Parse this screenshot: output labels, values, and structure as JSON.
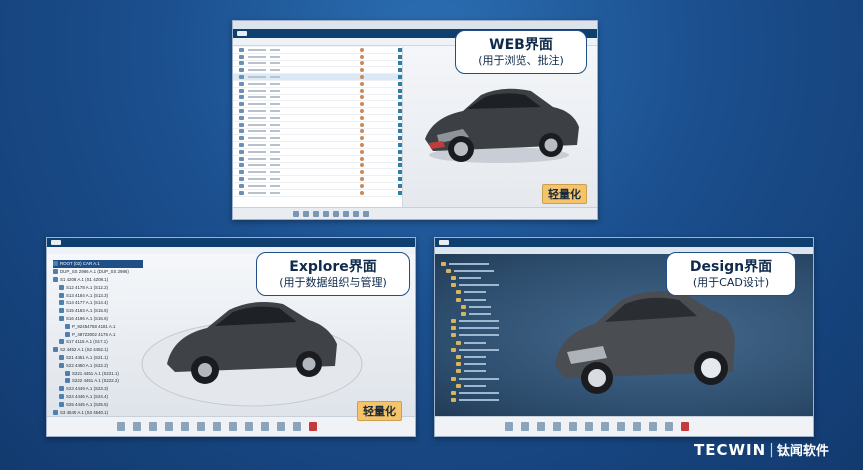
{
  "callouts": {
    "web": {
      "title": "WEB界面",
      "subtitle": "(用于浏览、批注)"
    },
    "explore": {
      "title": "Explore界面",
      "subtitle": "(用于数据组织与管理)"
    },
    "design": {
      "title": "Design界面",
      "subtitle": "(用于CAD设计)"
    }
  },
  "badges": {
    "web": "轻量化",
    "explore": "轻量化"
  },
  "explore_tree": [
    "ROOT (02) CAR A.1",
    "DUP_SS 2986 A.1 (DUP_SS 2986)",
    "S1 4208 A.1 (S1 4208.1)",
    "S12 4178 A.1 (S12.2)",
    "S13 4184 A.1 (S13.3)",
    "S14 4177 A.1 (S14.4)",
    "S15 4183 A.1 (S15.5)",
    "S16 4196 A.1 (S16.6)",
    "P_92454758 4181 A.1",
    "P_48723002 4176 A.1",
    "S17 4115 A.1 (S17.1)",
    "S2 4452 A.1 (S2 4452.1)",
    "S21 4451 A.1 (S21.1)",
    "S22 4450 A.1 (S22.2)",
    "S221 4451 A.1 (S221.1)",
    "S222 4451 A.1 (S222.2)",
    "S23 4449 A.1 (S23.3)",
    "S24 4446 A.1 (S24.4)",
    "S25 4445 A.1 (S25.5)",
    "S3 4540 A.1 (S3 4540.1)",
    "S4 4664 A.1 (S4 4664.1)"
  ],
  "brand": {
    "mark": "TECWIN",
    "name": "钛闻软件"
  },
  "colors": {
    "frame": "#1f4f86",
    "badge": "#f4c36a",
    "background": "#1b4f8e"
  }
}
